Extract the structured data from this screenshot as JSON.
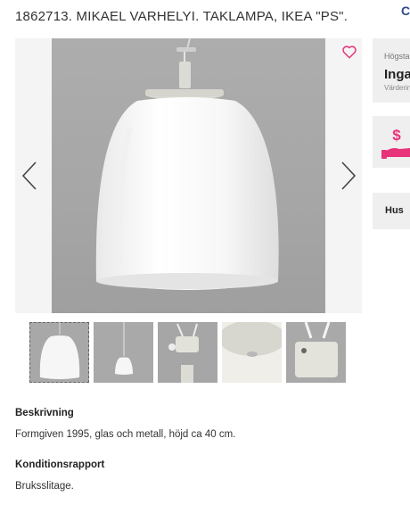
{
  "lot": {
    "title": "1862713. MIKAEL VARHELYI. TAKLAMPA, IKEA \"PS\"."
  },
  "gallery": {
    "thumbnail_count": 5,
    "active_thumbnail": 1
  },
  "sidebar": {
    "bid_label": "Högsta",
    "bid_value": "Inga",
    "valuation_label": "Värderin",
    "house_label": "Hus"
  },
  "description": {
    "heading": "Beskrivning",
    "text": "Formgiven 1995, glas och metall, höjd ca 40 cm."
  },
  "condition": {
    "heading": "Konditionsrapport",
    "text": "Bruksslitage."
  },
  "colors": {
    "accent_pink": "#e8327a",
    "brand_blue": "#2d4a86"
  },
  "icons": {
    "favorite": "heart-outline-icon",
    "prev": "chevron-left-icon",
    "next": "chevron-right-icon",
    "payment": "hand-dollar-icon"
  }
}
